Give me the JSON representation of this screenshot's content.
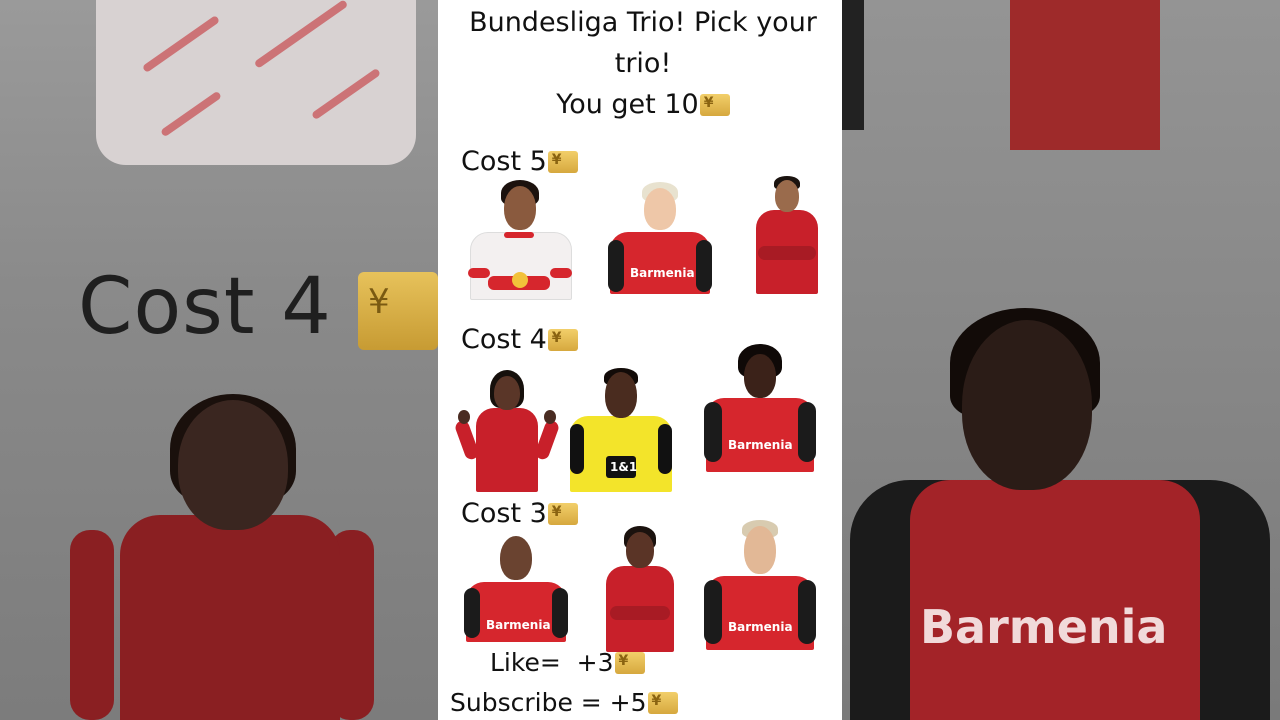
{
  "title": {
    "line1": "Bundesliga Trio! Pick your",
    "line2": "trio!",
    "line3": "You get 10"
  },
  "background": {
    "cost_text": "Cost 4",
    "right_brand": "Barmenia"
  },
  "tiers": [
    {
      "label": "Cost 5",
      "players": [
        {
          "kit": "white-redbull",
          "brand": ""
        },
        {
          "kit": "leverkusen",
          "brand": "Barmenia"
        },
        {
          "kit": "bayern",
          "brand": ""
        }
      ]
    },
    {
      "label": "Cost 4",
      "players": [
        {
          "kit": "bayern",
          "brand": ""
        },
        {
          "kit": "dortmund",
          "brand": "1&1"
        },
        {
          "kit": "leverkusen",
          "brand": "Barmenia"
        }
      ]
    },
    {
      "label": "Cost 3",
      "players": [
        {
          "kit": "leverkusen",
          "brand": "Barmenia"
        },
        {
          "kit": "bayern",
          "brand": ""
        },
        {
          "kit": "leverkusen",
          "brand": "Barmenia"
        }
      ]
    }
  ],
  "footer": {
    "like": "Like=  +3",
    "subscribe": "Subscribe = +5"
  },
  "icons": {
    "currency": "yen-banknote-icon"
  },
  "colors": {
    "gold": "#e0b64f",
    "leverkusen_red": "#d6262d",
    "bayern_red": "#c8202a",
    "dortmund_yellow": "#f3e42a"
  }
}
